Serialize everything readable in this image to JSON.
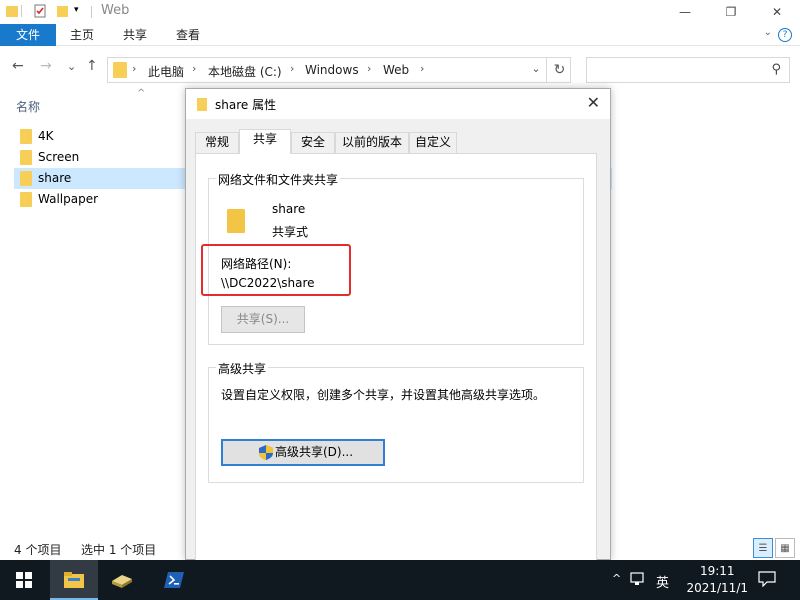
{
  "window": {
    "title": "Web",
    "minimize_glyph": "—",
    "maximize_glyph": "❐",
    "close_glyph": "✕"
  },
  "ribbon": {
    "tabs": [
      "文件",
      "主页",
      "共享",
      "查看"
    ],
    "help_glyph": "?",
    "accent_color": "#1979ca"
  },
  "nav": {
    "back": "←",
    "forward": "→",
    "recent": "⌄",
    "up": "↑",
    "breadcrumbs": [
      "此电脑",
      "本地磁盘 (C:)",
      "Windows",
      "Web"
    ],
    "sep": "›",
    "dropdown": "⌄",
    "refresh": "↻",
    "search_placeholder": "",
    "search_icon": "⚲"
  },
  "list": {
    "column_name": "名称",
    "sort_arrow": "^",
    "items": [
      {
        "name": "4K",
        "selected": false
      },
      {
        "name": "Screen",
        "selected": false
      },
      {
        "name": "share",
        "selected": true
      },
      {
        "name": "Wallpaper",
        "selected": false
      }
    ]
  },
  "status": {
    "count": "4 个项目",
    "selection": "选中 1 个项目"
  },
  "dialog": {
    "title": "share 属性",
    "close_glyph": "✕",
    "tabs": [
      "常规",
      "共享",
      "安全",
      "以前的版本",
      "自定义"
    ],
    "active_tab": "共享",
    "network_group_label": "网络文件和文件夹共享",
    "folder_name": "share",
    "share_state": "共享式",
    "network_path_label": "网络路径(N):",
    "network_path": "\\\\DC2022\\share",
    "share_button": "共享(S)...",
    "advanced_group_label": "高级共享",
    "advanced_desc": "设置自定义权限，创建多个共享，并设置其他高级共享选项。",
    "advanced_button": "高级共享(D)...",
    "highlight_color": "#e42c2c"
  },
  "taskbar": {
    "start_icon": "windows-logo",
    "tray_up": "^",
    "ime": "英",
    "time": "19:11",
    "date": "2021/11/1",
    "notification_icon": "action-center"
  }
}
